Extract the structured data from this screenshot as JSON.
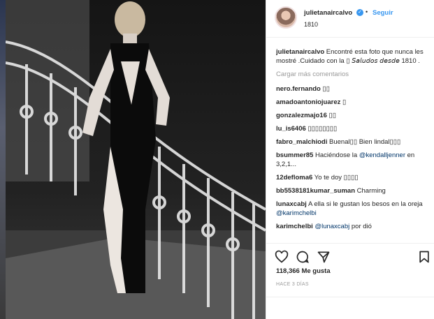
{
  "header": {
    "username": "julietanaircalvo",
    "follow_label": "Seguir",
    "separator": "•",
    "subtitle": "1810"
  },
  "caption": {
    "username": "julietanaircalvo",
    "text": " Encontré esta foto que nunca les mostré .Cuidado con la ▯ 𝘚𝘢𝘭𝘶𝘥𝘰𝘴 𝘥𝘦𝘴𝘥𝘦 1810 ."
  },
  "load_more_label": "Cargar más comentarios",
  "comments": [
    {
      "user": "nero.fernando",
      "text": " ▯▯",
      "mention": ""
    },
    {
      "user": "amadoantoniojuarez",
      "text": " ▯",
      "mention": ""
    },
    {
      "user": "gonzalezmajo16",
      "text": " ▯▯",
      "mention": ""
    },
    {
      "user": "lu_is6406",
      "text": " ▯▯▯▯▯▯▯▯",
      "mention": ""
    },
    {
      "user": "fabro_malchiodi",
      "text": " Buenal▯▯ Bien lindal▯▯▯",
      "mention": ""
    },
    {
      "user": "bsummer85",
      "text": " Haciéndose la ",
      "mention": "@kendalljenner",
      "after": " en 3,2,1..."
    },
    {
      "user": "12defloma6",
      "text": " Yo te doy ▯▯▯▯",
      "mention": ""
    },
    {
      "user": "bb5538181kumar_suman",
      "text": " Charming",
      "mention": ""
    },
    {
      "user": "lunaxcabj",
      "text": " A ella si le gustan los besos en la oreja ",
      "mention": "@karimchelbi",
      "after": ""
    },
    {
      "user": "karimchelbi",
      "text": " ",
      "mention": "@lunaxcabj",
      "after": " por dió"
    }
  ],
  "likes": "118,366 Me gusta",
  "time": "HACE 3 DÍAS",
  "icons": {
    "heart": "heart-icon",
    "comment": "comment-icon",
    "share": "share-icon",
    "save": "bookmark-icon",
    "verified": "verified-badge-icon",
    "more": "more-options-icon"
  },
  "colors": {
    "link": "#3897f0",
    "mention": "#003569",
    "muted": "#999999"
  }
}
